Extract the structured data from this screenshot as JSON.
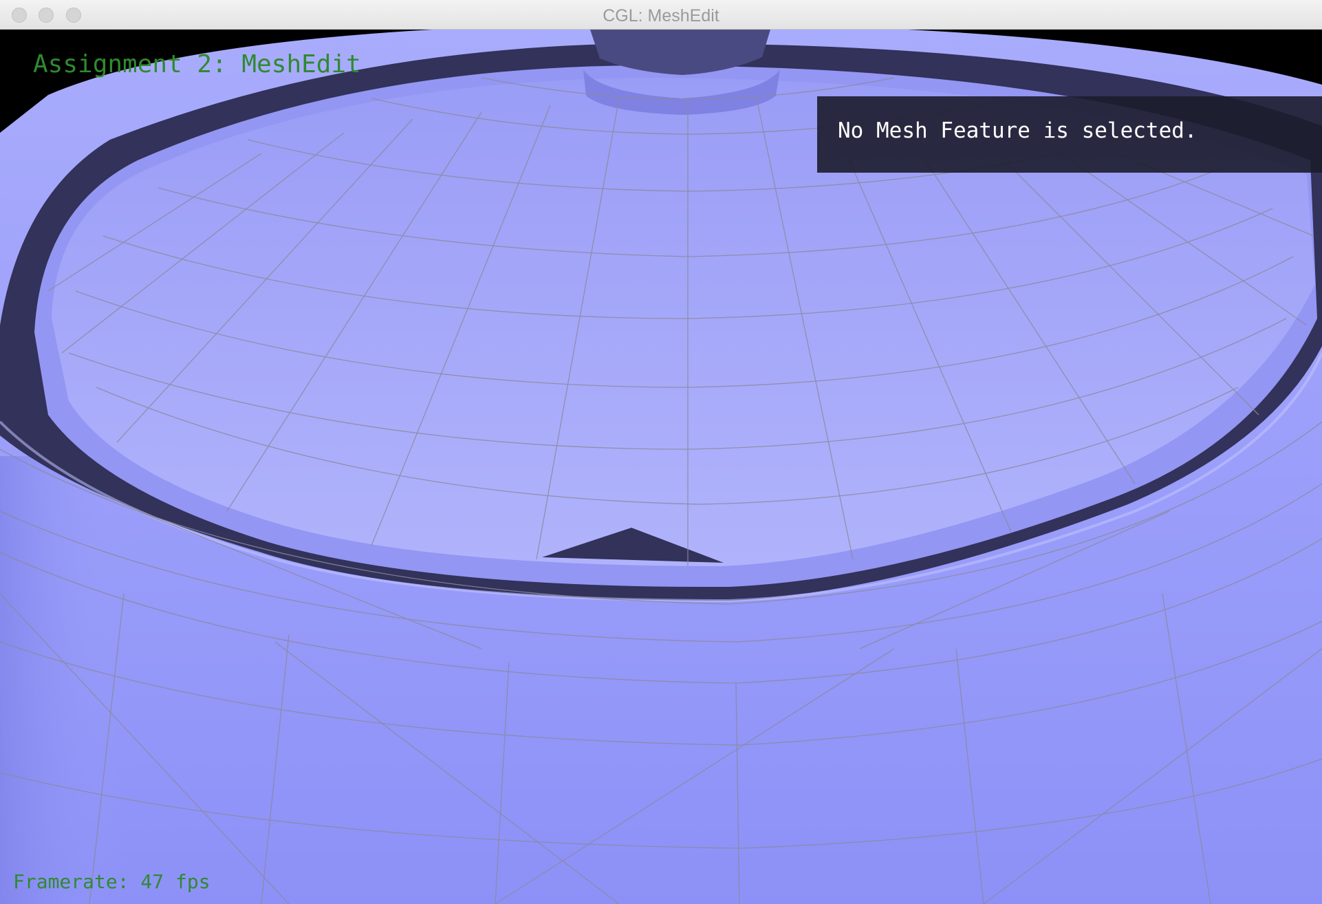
{
  "window": {
    "title": "CGL: MeshEdit"
  },
  "hud": {
    "title": "Assignment 2: MeshEdit",
    "framerate": "Framerate: 47 fps"
  },
  "info_panel": {
    "message": "No Mesh Feature is selected."
  },
  "colors": {
    "background": "#000000",
    "mesh_fill": "#9ea1fb",
    "mesh_shadow": "#32325a",
    "wireframe": "#8a8aa0",
    "hud_text": "#2f8a2f",
    "panel_bg": "#1c1c2c",
    "panel_text": "#ffffff"
  },
  "icons": [
    "close-button",
    "minimize-button",
    "zoom-button"
  ]
}
